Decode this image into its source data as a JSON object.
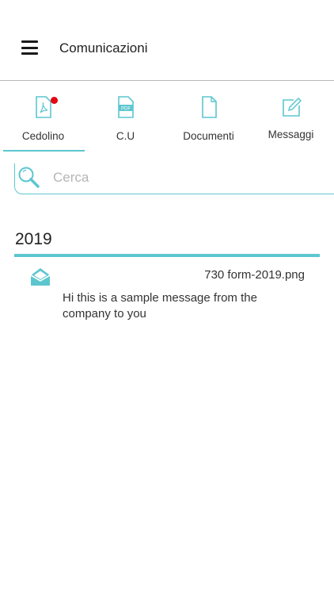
{
  "header": {
    "title": "Comunicazioni",
    "menu_icon": "hamburger-menu-icon"
  },
  "tabs": [
    {
      "label": "Cedolino",
      "icon": "pdf-document-icon",
      "active": true,
      "badge": true
    },
    {
      "label": "C.U",
      "icon": "pdf-file-icon",
      "active": false
    },
    {
      "label": "Documenti",
      "icon": "blank-document-icon",
      "active": false
    },
    {
      "label": "Messaggi",
      "icon": "edit-message-icon",
      "active": false
    }
  ],
  "search": {
    "placeholder": "Cerca",
    "value": ""
  },
  "sections": [
    {
      "year": "2019",
      "items": [
        {
          "icon": "open-envelope-icon",
          "filename": "730 form-2019.png",
          "message": "Hi this is a sample message from the company to you"
        }
      ]
    }
  ],
  "colors": {
    "accent": "#5cc6cf",
    "badge": "#e30613"
  }
}
